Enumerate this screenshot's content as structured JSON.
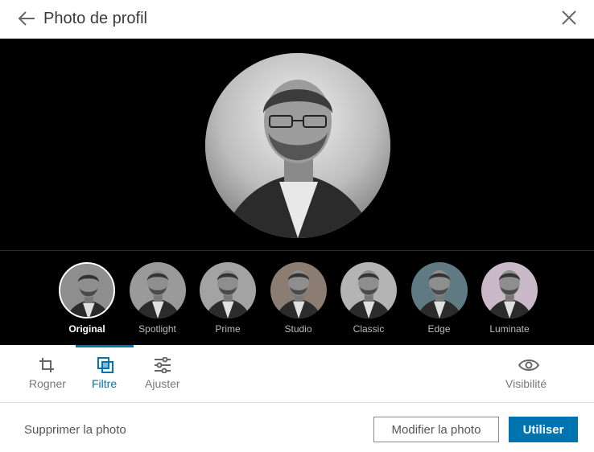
{
  "header": {
    "title": "Photo de profil",
    "back_icon": "arrow-left-icon",
    "close_icon": "close-icon"
  },
  "filters": {
    "items": [
      {
        "label": "Original",
        "selected": true,
        "tint": "#8e8e8e"
      },
      {
        "label": "Spotlight",
        "selected": false,
        "tint": "#9a9a9a"
      },
      {
        "label": "Prime",
        "selected": false,
        "tint": "#a3a3a3"
      },
      {
        "label": "Studio",
        "selected": false,
        "tint": "#8b7d72"
      },
      {
        "label": "Classic",
        "selected": false,
        "tint": "#b4b4b4"
      },
      {
        "label": "Edge",
        "selected": false,
        "tint": "#5f7a82"
      },
      {
        "label": "Luminate",
        "selected": false,
        "tint": "#c9b9c9"
      }
    ]
  },
  "tools": {
    "crop_label": "Rogner",
    "filter_label": "Filtre",
    "adjust_label": "Ajuster",
    "visibility_label": "Visibilité",
    "active": "filter"
  },
  "footer": {
    "delete_label": "Supprimer la photo",
    "modify_label": "Modifier la photo",
    "use_label": "Utiliser"
  },
  "colors": {
    "accent": "#0073b1",
    "stage_bg": "#000000"
  }
}
